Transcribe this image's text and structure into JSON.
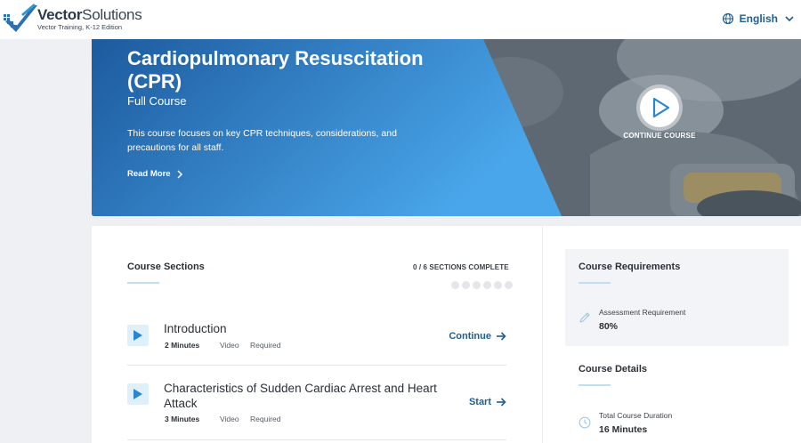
{
  "header": {
    "brand_bold": "Vector",
    "brand_light": "Solutions",
    "brand_tagline": "Vector Training, K-12 Edition",
    "language": "English",
    "icons": {
      "globe": "globe-icon",
      "chevron": "chevron-down-icon"
    }
  },
  "hero": {
    "title": "Cardiopulmonary Resuscitation (CPR)",
    "subtitle": "Full Course",
    "description": "This course focuses on key CPR techniques, considerations, and precautions for all staff.",
    "read_more": "Read More",
    "continue_label": "CONTINUE COURSE",
    "colors": {
      "gradient_start": "#1d5a9e",
      "gradient_end": "#4aa6ea"
    }
  },
  "sections": {
    "title": "Course Sections",
    "progress_text": "0 / 6 SECTIONS COMPLETE",
    "completed": 0,
    "total": 6,
    "items": [
      {
        "title": "Introduction",
        "duration": "2 Minutes",
        "type": "Video",
        "status": "Required",
        "action": "Continue"
      },
      {
        "title": "Characteristics of Sudden Cardiac Arrest and Heart Attack",
        "duration": "3 Minutes",
        "type": "Video",
        "status": "Required",
        "action": "Start"
      }
    ]
  },
  "requirements": {
    "title": "Course Requirements",
    "label": "Assessment Requirement",
    "value": "80%"
  },
  "details": {
    "title": "Course Details",
    "label": "Total Course Duration",
    "value": "16 Minutes"
  },
  "colors": {
    "accent": "#1f5e8e",
    "accent_light": "#bfe0f2",
    "panel_bg": "#f2f4f7"
  }
}
